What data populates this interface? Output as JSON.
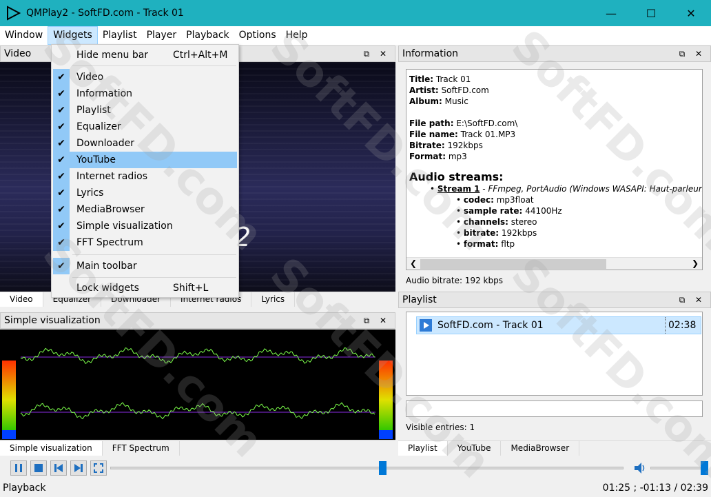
{
  "window": {
    "title": "QMPlay2 - SoftFD.com - Track 01",
    "icon": "play-triangle-icon",
    "accent": "#1fb1bf"
  },
  "menubar": [
    "Window",
    "Widgets",
    "Playlist",
    "Player",
    "Playback",
    "Options",
    "Help"
  ],
  "widgets_menu": {
    "hide_menu_bar": "Hide menu bar",
    "hide_menu_bar_shortcut": "Ctrl+Alt+M",
    "items": [
      "Video",
      "Information",
      "Playlist",
      "Equalizer",
      "Downloader",
      "YouTube",
      "Internet radios",
      "Lyrics",
      "MediaBrowser",
      "Simple visualization",
      "FFT Spectrum"
    ],
    "highlighted": "YouTube",
    "main_toolbar": "Main toolbar",
    "lock_widgets": "Lock widgets",
    "lock_widgets_shortcut": "Shift+L"
  },
  "video": {
    "title": "Video",
    "overlay_text": "2"
  },
  "left_tabs": [
    "Video",
    "Equalizer",
    "Downloader",
    "Internet radios",
    "Lyrics"
  ],
  "simple_viz": {
    "title": "Simple visualization"
  },
  "viz_tabs": [
    "Simple visualization",
    "FFT Spectrum"
  ],
  "information": {
    "title": "Information",
    "meta": [
      {
        "k": "Title:",
        "v": "Track 01"
      },
      {
        "k": "Artist:",
        "v": "SoftFD.com"
      },
      {
        "k": "Album:",
        "v": "Music"
      }
    ],
    "file": [
      {
        "k": "File path:",
        "v": "E:\\SoftFD.com\\"
      },
      {
        "k": "File name:",
        "v": "Track 01.MP3"
      },
      {
        "k": "Bitrate:",
        "v": "192kbps"
      },
      {
        "k": "Format:",
        "v": "mp3"
      }
    ],
    "streams_heading": "Audio streams:",
    "stream_name": "Stream 1",
    "stream_desc": " - FFmpeg, PortAudio (Windows WASAPI: Haut-parleurs",
    "stream_props": [
      {
        "k": "codec:",
        "v": "mp3float"
      },
      {
        "k": "sample rate:",
        "v": "44100Hz"
      },
      {
        "k": "channels:",
        "v": "stereo"
      },
      {
        "k": "bitrate:",
        "v": "192kbps"
      },
      {
        "k": "format:",
        "v": "fltp"
      }
    ],
    "audio_bitrate": "Audio bitrate: 192 kbps"
  },
  "playlist": {
    "title": "Playlist",
    "entries": [
      {
        "name": "SoftFD.com - Track 01",
        "length": "02:38"
      }
    ],
    "visible_entries": "Visible entries: 1"
  },
  "right_tabs": [
    "Playlist",
    "YouTube",
    "MediaBrowser"
  ],
  "controls": {
    "buttons": [
      "pause-icon",
      "stop-icon",
      "previous-icon",
      "next-icon",
      "fullscreen-icon"
    ],
    "seek_fraction": 0.53,
    "volume_fraction": 1.0
  },
  "status": {
    "left": "Playback",
    "right": "01:25 ; -01:13 / 02:39"
  },
  "watermark": "SoftFD.com"
}
